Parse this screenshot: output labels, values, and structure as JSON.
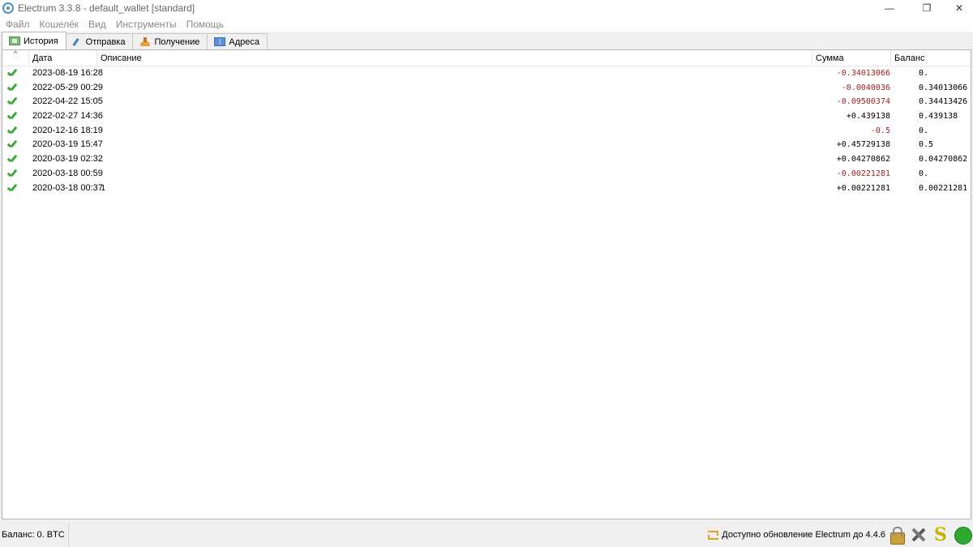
{
  "window": {
    "title": "Electrum 3.3.8  -  default_wallet  [standard]",
    "minimize": "—",
    "maximize": "❐",
    "close": "✕"
  },
  "menu": [
    "Файл",
    "Кошелёк",
    "Вид",
    "Инструменты",
    "Помощь"
  ],
  "tabs": [
    {
      "label": "История",
      "icon": "history-icon",
      "active": true
    },
    {
      "label": "Отправка",
      "icon": "send-icon",
      "active": false
    },
    {
      "label": "Получение",
      "icon": "receive-icon",
      "active": false
    },
    {
      "label": "Адреса",
      "icon": "addresses-icon",
      "active": false
    }
  ],
  "history": {
    "sort_indicator": "^",
    "columns": {
      "date": "Дата",
      "description": "Описание",
      "amount": "Сумма",
      "balance": "Баланс"
    },
    "rows": [
      {
        "date": "2023-08-19 16:28",
        "description": "",
        "amount": "-0.34013066",
        "balance": "0.",
        "negative": true
      },
      {
        "date": "2022-05-29 00:29",
        "description": "",
        "amount": "-0.0040036",
        "balance": "0.34013066",
        "negative": true
      },
      {
        "date": "2022-04-22 15:05",
        "description": "",
        "amount": "-0.09500374",
        "balance": "0.34413426",
        "negative": true
      },
      {
        "date": "2022-02-27 14:36",
        "description": "",
        "amount": "+0.439138",
        "balance": "0.439138",
        "negative": false
      },
      {
        "date": "2020-12-16 18:19",
        "description": "",
        "amount": "-0.5",
        "balance": "0.",
        "negative": true
      },
      {
        "date": "2020-03-19 15:47",
        "description": "",
        "amount": "+0.45729138",
        "balance": "0.5",
        "negative": false
      },
      {
        "date": "2020-03-19 02:32",
        "description": "",
        "amount": "+0.04270862",
        "balance": "0.04270862",
        "negative": false
      },
      {
        "date": "2020-03-18 00:59",
        "description": "",
        "amount": "-0.00221281",
        "balance": "0.",
        "negative": true
      },
      {
        "date": "2020-03-18 00:37",
        "description": "1",
        "amount": "+0.00221281",
        "balance": "0.00221281",
        "negative": false
      }
    ]
  },
  "statusbar": {
    "balance": "Баланс: 0. BTC",
    "update": "Доступно обновление Electrum до 4.4.6",
    "seed_glyph": "S"
  },
  "colors": {
    "negative_amount": "#a32020",
    "status_connected": "#2fa82f",
    "check": "#3aa83a"
  }
}
